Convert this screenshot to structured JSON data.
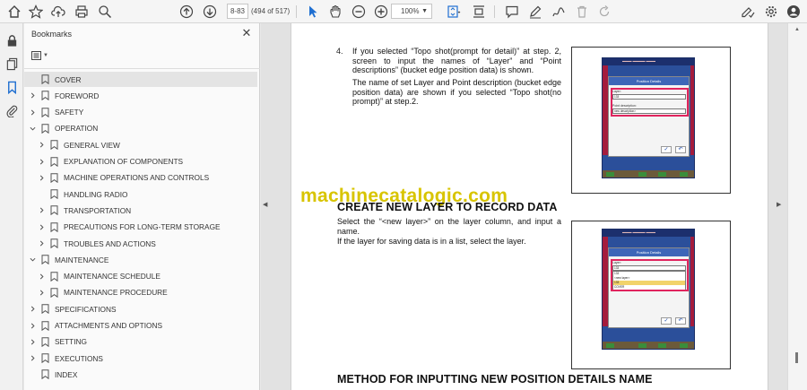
{
  "toolbar": {
    "page_input": "8-83",
    "page_count": "(494 of 517)",
    "zoom": "100%"
  },
  "bookmarks": {
    "title": "Bookmarks",
    "items": [
      {
        "label": "COVER",
        "level": 0,
        "chevron": "none",
        "selected": true
      },
      {
        "label": "FOREWORD",
        "level": 0,
        "chevron": "right"
      },
      {
        "label": "SAFETY",
        "level": 0,
        "chevron": "right"
      },
      {
        "label": "OPERATION",
        "level": 0,
        "chevron": "down"
      },
      {
        "label": "GENERAL VIEW",
        "level": 1,
        "chevron": "right"
      },
      {
        "label": "EXPLANATION OF COMPONENTS",
        "level": 1,
        "chevron": "right"
      },
      {
        "label": "MACHINE OPERATIONS AND CONTROLS",
        "level": 1,
        "chevron": "right"
      },
      {
        "label": "HANDLING RADIO",
        "level": 1,
        "chevron": "none"
      },
      {
        "label": "TRANSPORTATION",
        "level": 1,
        "chevron": "right"
      },
      {
        "label": "PRECAUTIONS FOR LONG-TERM STORAGE",
        "level": 1,
        "chevron": "right"
      },
      {
        "label": "TROUBLES AND ACTIONS",
        "level": 1,
        "chevron": "right"
      },
      {
        "label": "MAINTENANCE",
        "level": 0,
        "chevron": "down"
      },
      {
        "label": "MAINTENANCE SCHEDULE",
        "level": 1,
        "chevron": "right"
      },
      {
        "label": "MAINTENANCE PROCEDURE",
        "level": 1,
        "chevron": "right"
      },
      {
        "label": "SPECIFICATIONS",
        "level": 0,
        "chevron": "right"
      },
      {
        "label": "ATTACHMENTS AND OPTIONS",
        "level": 0,
        "chevron": "right"
      },
      {
        "label": "SETTING",
        "level": 0,
        "chevron": "right"
      },
      {
        "label": "EXECUTIONS",
        "level": 0,
        "chevron": "right"
      },
      {
        "label": "INDEX",
        "level": 0,
        "chevron": "none"
      }
    ]
  },
  "page": {
    "step_number": "4.",
    "step_text_1": "If you selected “Topo shot(prompt for detail)” at step. 2, screen to input the names of “Layer” and “Point descriptions” (bucket edge position data) is shown.",
    "step_text_2": "The name of set Layer and Point description (bucket edge position data) are shown if you selected “Topo shot(no prompt)” at step.2.",
    "watermark": "machinecatalogic.com",
    "heading_1": "CREATE NEW LAYER TO RECORD DATA",
    "body_1a": "Select the “<new layer>” on the layer column, and input a name.",
    "body_1b": "If the layer for saving data is in a list, select the layer.",
    "heading_2": "METHOD FOR INPUTTING NEW POSITION DETAILS NAME",
    "screen1": {
      "title": "Position Details",
      "layer_label": "Layer:",
      "layer_value": "133",
      "desc_label": "Point description:",
      "desc_value": "new description>"
    },
    "screen2": {
      "title": "Position Details",
      "layer_label": "Layer:",
      "layer_value": "133",
      "list": [
        "133",
        "<new layer>",
        "133",
        "COVER"
      ]
    }
  }
}
